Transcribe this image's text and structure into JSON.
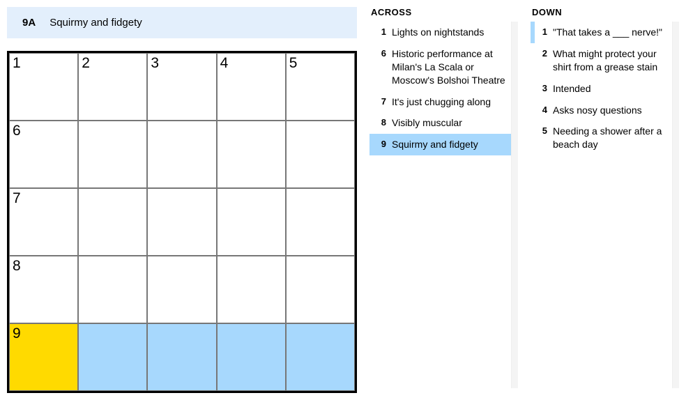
{
  "current_clue": {
    "label": "9A",
    "text": "Squirmy and fidgety"
  },
  "grid": {
    "rows": 5,
    "cols": 5,
    "cells": [
      [
        {
          "num": "1"
        },
        {
          "num": "2"
        },
        {
          "num": "3"
        },
        {
          "num": "4"
        },
        {
          "num": "5"
        }
      ],
      [
        {
          "num": "6"
        },
        {},
        {},
        {},
        {}
      ],
      [
        {
          "num": "7"
        },
        {},
        {},
        {},
        {}
      ],
      [
        {
          "num": "8"
        },
        {},
        {},
        {},
        {}
      ],
      [
        {
          "num": "9",
          "state": "focused"
        },
        {
          "state": "active"
        },
        {
          "state": "active"
        },
        {
          "state": "active"
        },
        {
          "state": "active"
        }
      ]
    ]
  },
  "across": {
    "heading": "ACROSS",
    "clues": [
      {
        "num": "1",
        "text": "Lights on nightstands"
      },
      {
        "num": "6",
        "text": "Historic performance at Milan's La Scala or Moscow's Bolshoi Theatre"
      },
      {
        "num": "7",
        "text": "It's just chugging along"
      },
      {
        "num": "8",
        "text": "Visibly muscular"
      },
      {
        "num": "9",
        "text": "Squirmy and fidgety",
        "selected": true
      }
    ]
  },
  "down": {
    "heading": "DOWN",
    "clues": [
      {
        "num": "1",
        "text": "\"That takes a ___ nerve!\"",
        "cross": true
      },
      {
        "num": "2",
        "text": "What might protect your shirt from a grease stain"
      },
      {
        "num": "3",
        "text": "Intended"
      },
      {
        "num": "4",
        "text": "Asks nosy questions"
      },
      {
        "num": "5",
        "text": "Needing a shower after a beach day"
      }
    ]
  }
}
